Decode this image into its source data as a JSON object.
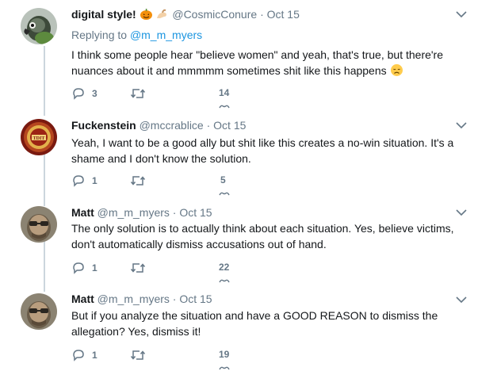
{
  "tweets": [
    {
      "name": "digital style!",
      "handle": "@CosmicConure",
      "dot": "·",
      "date": "Oct 15",
      "replying_prefix": "Replying to ",
      "replying_to": "@m_m_myers",
      "text": "I think some people hear \"believe women\" and yeah, that's true, but there're nuances about it and mmmmm sometimes shit like this happens",
      "replies": "3",
      "retweets": "",
      "likes": "14"
    },
    {
      "name": "Fuckenstein",
      "handle": "@mccrablice",
      "dot": "·",
      "date": "Oct 15",
      "text": "Yeah, I want to be a good ally but shit like this creates a no-win situation. It's a shame and I don't know the solution.",
      "replies": "1",
      "retweets": "",
      "likes": "5"
    },
    {
      "name": "Matt",
      "handle": "@m_m_myers",
      "dot": "·",
      "date": "Oct 15",
      "text": "The only solution is to actually think about each situation. Yes, believe victims, don't automatically dismiss accusations out of hand.",
      "replies": "1",
      "retweets": "",
      "likes": "22"
    },
    {
      "name": "Matt",
      "handle": "@m_m_myers",
      "dot": "·",
      "date": "Oct 15",
      "text": "But if you analyze the situation and have a GOOD REASON to dismiss the allegation? Yes, dismiss it!",
      "replies": "1",
      "retweets": "",
      "likes": "19"
    }
  ],
  "colors": {
    "text": "#14171a",
    "secondary": "#657786",
    "link": "#1b95e0",
    "thread_line": "#ccd6dd"
  }
}
